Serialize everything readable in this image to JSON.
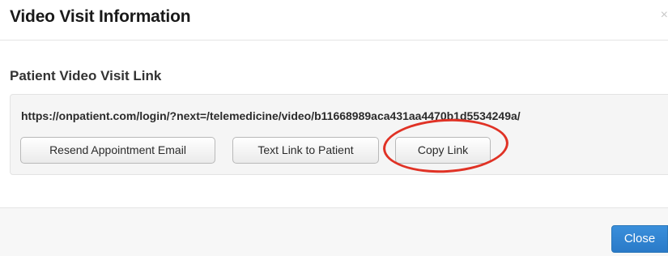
{
  "modal": {
    "title": "Video Visit Information",
    "close_icon": "×"
  },
  "section": {
    "title": "Patient Video Visit Link",
    "url": "https://onpatient.com/login/?next=/telemedicine/video/b11668989aca431aa4470b1d5534249a/"
  },
  "actions": {
    "resend_label": "Resend Appointment Email",
    "text_link_label": "Text Link to Patient",
    "copy_link_label": "Copy Link"
  },
  "footer": {
    "close_label": "Close"
  },
  "colors": {
    "primary_button": "#2a7ac8",
    "highlight_ring": "#e03225"
  },
  "icons": {
    "close": "close-icon"
  }
}
